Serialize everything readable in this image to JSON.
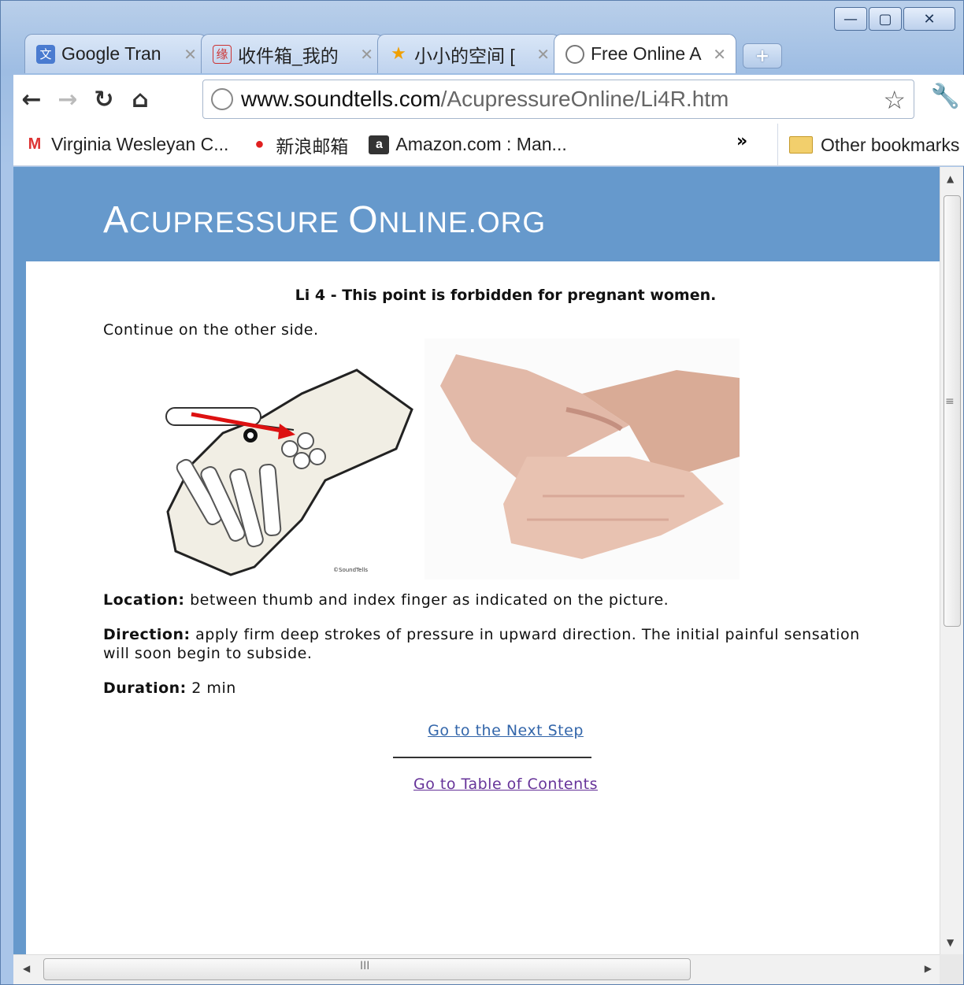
{
  "window": {
    "controls": {
      "minimize": "—",
      "maximize": "▢",
      "close": "✕"
    }
  },
  "tabs": [
    {
      "title": "Google Tran",
      "icon": "google-translate-icon",
      "active": false
    },
    {
      "title": "收件箱_我的",
      "icon": "mail-icon",
      "active": false
    },
    {
      "title": "小小的空间 [",
      "icon": "star-favicon-icon",
      "active": false
    },
    {
      "title": "Free Online A",
      "icon": "globe-icon",
      "active": true
    }
  ],
  "toolbar": {
    "url_domain": "www.soundtells.com",
    "url_path": "/AcupressureOnline/Li4R.htm"
  },
  "bookmarks": {
    "items": [
      {
        "label": "Virginia Wesleyan C...",
        "icon": "gmail-icon"
      },
      {
        "label": "新浪邮箱",
        "icon": "sina-weibo-icon"
      },
      {
        "label": "Amazon.com : Man...",
        "icon": "amazon-icon"
      }
    ],
    "overflow": "»",
    "other": "Other bookmarks"
  },
  "page": {
    "logo_part1_cap": "A",
    "logo_part1_rest": "CUPRESSURE ",
    "logo_part2_cap": "O",
    "logo_part2_rest": "NLINE.ORG",
    "heading": "Li 4 - This point is forbidden for pregnant women.",
    "continue": "Continue on the other side.",
    "illustration_credit": "©SoundTells",
    "location_label": "Location:",
    "location_text": " between thumb and index finger as indicated on the picture.",
    "direction_label": "Direction:",
    "direction_text": " apply firm deep strokes of pressure in upward direction. The initial painful sensation will soon begin to subside.",
    "duration_label": "Duration:",
    "duration_text": " 2 min",
    "next_link": "Go to the Next Step",
    "toc_link": "Go to Table of Contents"
  },
  "colors": {
    "header_bg": "#6699cc",
    "link": "#3366aa",
    "visited_link": "#663399"
  }
}
